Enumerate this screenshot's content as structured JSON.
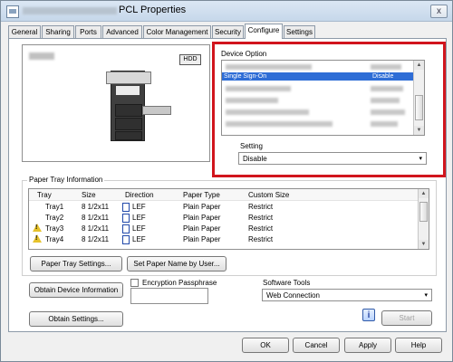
{
  "window": {
    "title": "PCL Properties",
    "close_label": "x"
  },
  "tabs": [
    "General",
    "Sharing",
    "Ports",
    "Advanced",
    "Color Management",
    "Security",
    "Configure",
    "Settings"
  ],
  "device_option": {
    "label": "Device Option",
    "selected_item": {
      "name": "Single Sign-On",
      "value": "Disable"
    }
  },
  "setting": {
    "label": "Setting",
    "value": "Disable"
  },
  "icons": {
    "hdd_label": "HDD",
    "info_icon_text": "i",
    "scroll_up": "▲",
    "scroll_down": "▼",
    "select_arrow": "▾"
  },
  "paper_tray": {
    "label": "Paper Tray Information",
    "headers": [
      "Tray",
      "Size",
      "Direction",
      "Paper Type",
      "Custom Size"
    ],
    "rows": [
      {
        "tray": "Tray1",
        "size": "8 1/2x11",
        "direction": "LEF",
        "paper_type": "Plain Paper",
        "custom_size": "Restrict",
        "warning": false
      },
      {
        "tray": "Tray2",
        "size": "8 1/2x11",
        "direction": "LEF",
        "paper_type": "Plain Paper",
        "custom_size": "Restrict",
        "warning": false
      },
      {
        "tray": "Tray3",
        "size": "8 1/2x11",
        "direction": "LEF",
        "paper_type": "Plain Paper",
        "custom_size": "Restrict",
        "warning": true
      },
      {
        "tray": "Tray4",
        "size": "8 1/2x11",
        "direction": "LEF",
        "paper_type": "Plain Paper",
        "custom_size": "Restrict",
        "warning": true
      }
    ],
    "paper_tray_settings_button": "Paper Tray Settings...",
    "set_paper_name_button": "Set Paper Name by User..."
  },
  "device_info_button": "Obtain Device Information",
  "encryption": {
    "label": "Encryption Passphrase",
    "value": ""
  },
  "software_tools": {
    "label": "Software Tools",
    "value": "Web Connection"
  },
  "obtain_settings_button": "Obtain Settings...",
  "start_button": "Start",
  "footer": {
    "ok": "OK",
    "cancel": "Cancel",
    "apply": "Apply",
    "help": "Help"
  }
}
